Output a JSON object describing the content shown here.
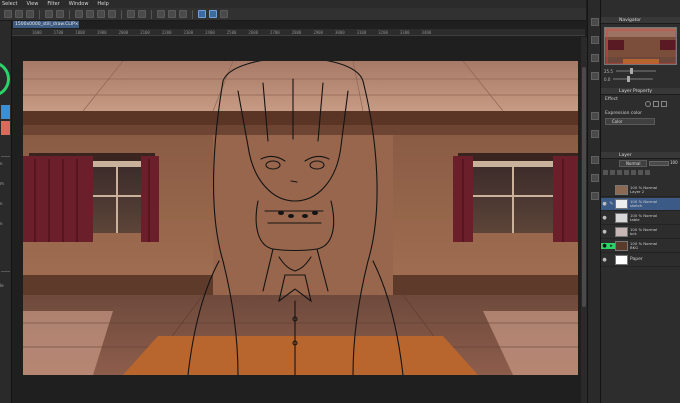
{
  "menu": [
    "Select",
    "View",
    "Filter",
    "Window",
    "Help"
  ],
  "doc_tab": {
    "title": "1500x0000_still_draw.CLIP",
    "close": "×"
  },
  "ruler_ticks": [
    "1600",
    "1700",
    "1800",
    "1900",
    "2000",
    "2100",
    "2200",
    "2300",
    "2400",
    "2500",
    "2600",
    "2700",
    "2800",
    "2900",
    "3000",
    "3100",
    "3200",
    "3300",
    "3400"
  ],
  "left_labels": [
    "n",
    "m",
    "n",
    "n",
    "le"
  ],
  "navigator": {
    "title": "Navigator",
    "zoom": "25.5",
    "rotation": "0.0"
  },
  "layer_property": {
    "title": "Layer Property",
    "effect_label": "Effect",
    "expression_color_label": "Expression color",
    "expression_color_value": "Color"
  },
  "layer_panel": {
    "title": "Layer",
    "blend_mode": "Normal",
    "opacity": "100"
  },
  "layers": [
    {
      "pct": "100 %",
      "mode": "Normal",
      "name": "Layer 2",
      "visible": false,
      "selected": false,
      "thumb": "#8a6a52"
    },
    {
      "pct": "100 %",
      "mode": "Normal",
      "name": "sketch",
      "visible": true,
      "selected": true,
      "thumb": "#eeeeee"
    },
    {
      "pct": "100 %",
      "mode": "Normal",
      "name": "table",
      "visible": true,
      "selected": false,
      "thumb": "#d8d8d8"
    },
    {
      "pct": "100 %",
      "mode": "Normal",
      "name": "bck",
      "visible": true,
      "selected": false,
      "thumb": "#c7b7b7"
    },
    {
      "pct": "100 %",
      "mode": "Normal",
      "name": "BKG",
      "visible": true,
      "selected": false,
      "thumb": "#5a3a2a"
    },
    {
      "pct": "",
      "mode": "",
      "name": "Paper",
      "visible": true,
      "selected": false,
      "thumb": "#ffffff"
    }
  ],
  "colors": {
    "accent": "#3b5b86",
    "panel_bg": "#2d2d2d",
    "canvas_bg": "#1f1f1f",
    "wheel": "#2ad468"
  }
}
